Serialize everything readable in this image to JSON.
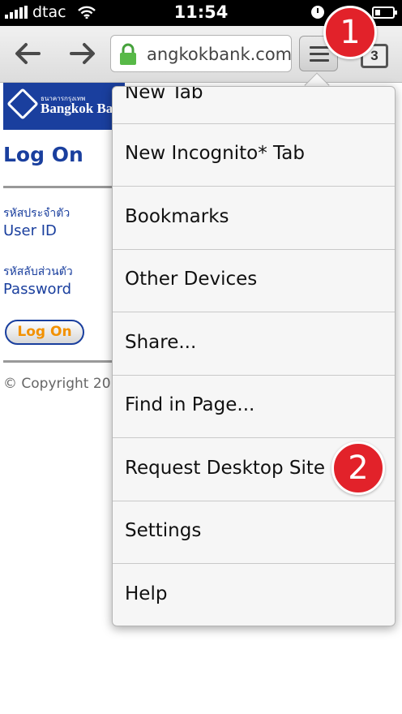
{
  "status_bar": {
    "carrier": "dtac",
    "time": "11:54"
  },
  "toolbar": {
    "url": "angkokbank.com",
    "tab_count": "3"
  },
  "page": {
    "logo_small_text": "ธนาคารกรุงเทพ",
    "logo_name": "Bangkok Bank",
    "title": "Log On",
    "user_id_th": "รหัสประจำตัว",
    "user_id_en": "User ID",
    "password_th": "รหัสลับส่วนตัว",
    "password_en": "Password",
    "logon_button": "Log On",
    "copyright": "© Copyright 20"
  },
  "menu": {
    "items": [
      "New Tab",
      "New Incognito* Tab",
      "Bookmarks",
      "Other Devices",
      "Share...",
      "Find in Page...",
      "Request Desktop Site",
      "Settings",
      "Help"
    ]
  },
  "annotations": {
    "step1": "1",
    "step2": "2"
  },
  "colors": {
    "brand_blue": "#1a3f9e",
    "logon_orange": "#f29100",
    "badge_red": "#e2222a"
  }
}
